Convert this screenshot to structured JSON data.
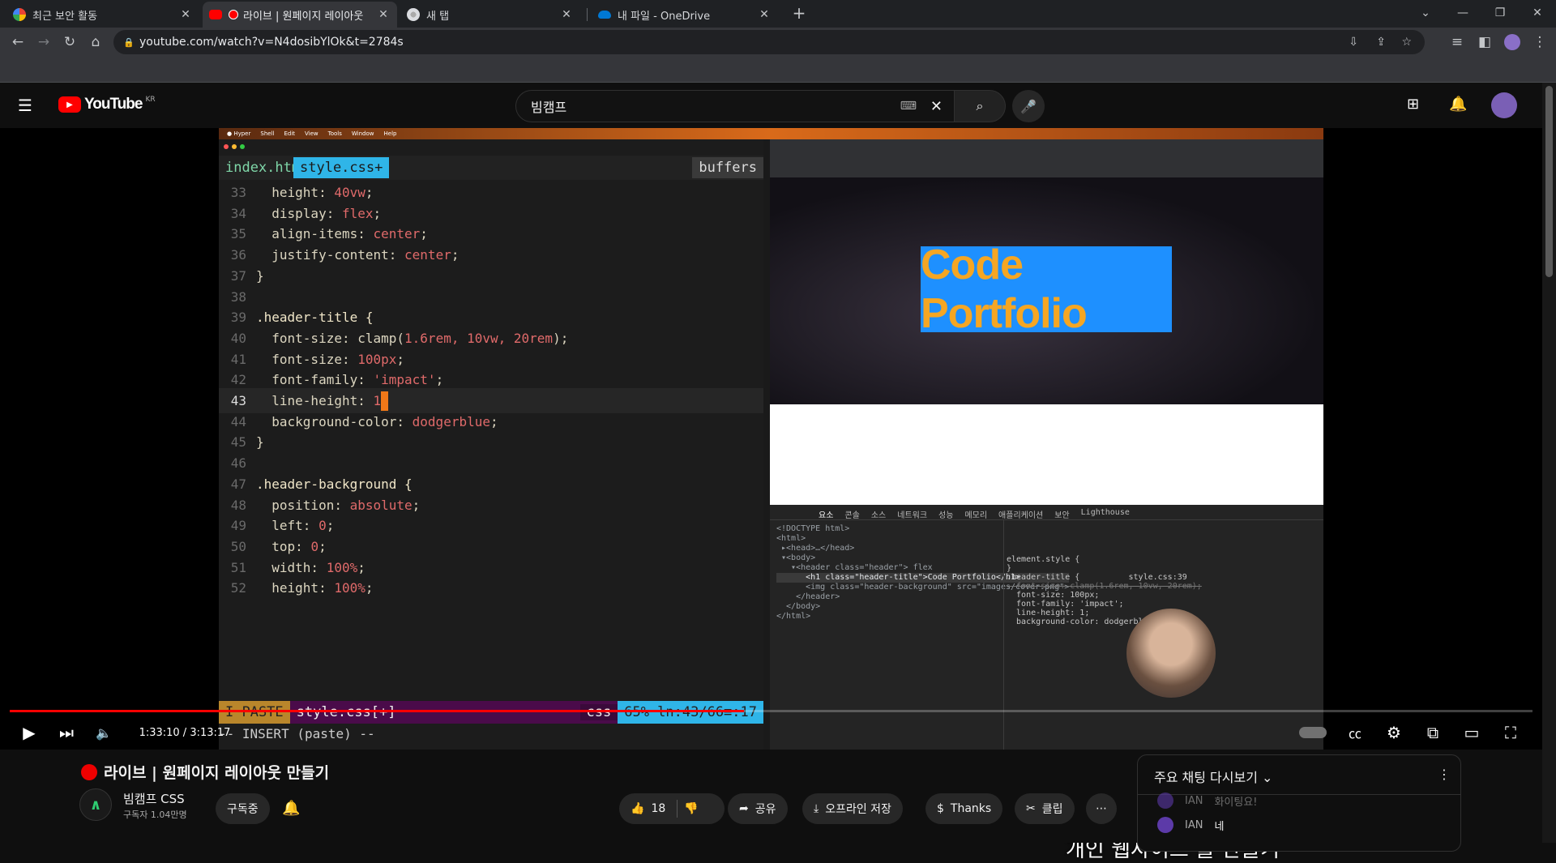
{
  "browser": {
    "tabs": [
      {
        "title": "최근 보안 활동",
        "icon": "google-icon"
      },
      {
        "title": "라이브 | 원페이지 레이아웃",
        "icon": "youtube-icon",
        "active": true
      },
      {
        "title": "새 탭",
        "icon": "chrome-icon"
      },
      {
        "title": "내 파일 - OneDrive",
        "icon": "onedrive-icon"
      }
    ],
    "url": "youtube.com/watch?v=N4dosibYlOk&t=2784s"
  },
  "youtube": {
    "logo": "YouTube",
    "region": "KR",
    "search_value": "빔캠프"
  },
  "video": {
    "vim_tabs": [
      "index.html",
      "style.css+",
      "buffers"
    ],
    "code_lines": [
      {
        "n": "33",
        "prop": "  height: ",
        "val": "40vw",
        "tail": ";"
      },
      {
        "n": "34",
        "prop": "  display: ",
        "val": "flex",
        "tail": ";"
      },
      {
        "n": "35",
        "prop": "  align-items: ",
        "val": "center",
        "tail": ";"
      },
      {
        "n": "36",
        "prop": "  justify-content: ",
        "val": "center",
        "tail": ";"
      },
      {
        "n": "37",
        "prop": "}",
        "val": "",
        "tail": ""
      },
      {
        "n": "38",
        "prop": "",
        "val": "",
        "tail": ""
      },
      {
        "n": "39",
        "prop": ".header-title {",
        "val": "",
        "tail": ""
      },
      {
        "n": "40",
        "prop": "  font-size: clamp(",
        "val": "1.6rem, 10vw, 20rem",
        "tail": ");"
      },
      {
        "n": "41",
        "prop": "  font-size: ",
        "val": "100px",
        "tail": ";"
      },
      {
        "n": "42",
        "prop": "  font-family: ",
        "val": "'impact'",
        "tail": ";"
      },
      {
        "n": "43",
        "prop": "  line-height: ",
        "val": "1",
        "tail": ""
      },
      {
        "n": "44",
        "prop": "  background-color: ",
        "val": "dodgerblue",
        "tail": ";"
      },
      {
        "n": "45",
        "prop": "}",
        "val": "",
        "tail": ""
      },
      {
        "n": "46",
        "prop": "",
        "val": "",
        "tail": ""
      },
      {
        "n": "47",
        "prop": ".header-background {",
        "val": "",
        "tail": ""
      },
      {
        "n": "48",
        "prop": "  position: ",
        "val": "absolute",
        "tail": ";"
      },
      {
        "n": "49",
        "prop": "  left: ",
        "val": "0",
        "tail": ";"
      },
      {
        "n": "50",
        "prop": "  top: ",
        "val": "0",
        "tail": ";"
      },
      {
        "n": "51",
        "prop": "  width: ",
        "val": "100%",
        "tail": ";"
      },
      {
        "n": "52",
        "prop": "  height: ",
        "val": "100%",
        "tail": ";"
      }
    ],
    "vim_status": {
      "mode": "I  PASTE",
      "file": "style.css[+]",
      "ft": "css",
      "pos": "65%  ln:43/66≡:17"
    },
    "vim_cmdline": "-- INSERT (paste) --",
    "preview_title": "Code Portfolio",
    "devtools_tabs": [
      "요소",
      "콘솔",
      "소스",
      "네트워크",
      "성능",
      "메모리",
      "애플리케이션",
      "보안",
      "Lighthouse"
    ],
    "devtools_lines": [
      "<!DOCTYPE html>",
      "<html>",
      " ▸<head>…</head>",
      " ▾<body>",
      "   ▾<header class=\"header\"> flex",
      "      <h1 class=\"header-title\">Code Portfolio</h1>",
      "      <img class=\"header-background\" src=\"images/cover.png\">",
      "    </header>",
      "  </body>",
      "</html>"
    ],
    "styles_lines": [
      "element.style {",
      "}",
      ".header-title {          style.css:39",
      "  font-size: clamp(1.6rem, 10vw, 20rem);",
      "  font-size: 100px;",
      "  font-family: 'impact';",
      "  line-height: 1;",
      "  background-color: dodgerblue;"
    ],
    "caption": "개인 웹사이트 틀 만들기"
  },
  "player": {
    "time": "1:33:10 / 3:13:17",
    "progress": 0.482
  },
  "meta": {
    "title": "라이브 | 원페이지 레이아웃 만들기",
    "channel": "빔캠프 CSS",
    "subscribers": "구독자 1.04만명",
    "subscribed_label": "구독중",
    "likes": "18",
    "share": "공유",
    "save_offline": "오프라인 저장",
    "thanks": "Thanks",
    "clip": "클립"
  },
  "chat": {
    "header": "주요 채팅 다시보기",
    "messages": [
      {
        "author": "IAN",
        "text": "화이팅요!"
      },
      {
        "author": "IAN",
        "text": "네"
      }
    ]
  }
}
